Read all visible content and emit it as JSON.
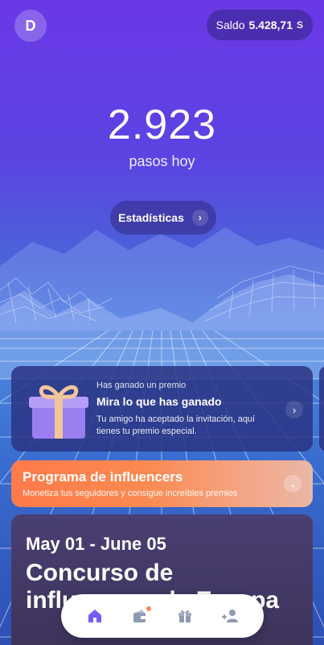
{
  "header": {
    "avatar_initial": "D",
    "balance_label": "Saldo",
    "balance_value": "5.428,71",
    "balance_currency_symbol": "S"
  },
  "steps": {
    "count": "2.923",
    "label": "pasos hoy",
    "stats_button": "Estadísticas"
  },
  "prize_card": {
    "kicker": "Has ganado un premio",
    "title": "Mira lo que has ganado",
    "description": "Tu amigo ha aceptado la invitación, aquí tienes tu premio especial."
  },
  "influencer_card": {
    "title": "Programa de influencers",
    "subtitle": "Monetiza tus seguidores y consigue increíbles premios"
  },
  "contest_card": {
    "dates": "May 01 - June 05",
    "title": "Concurso de influencers de Europa"
  },
  "tabbar": {
    "items": [
      "home-icon",
      "wallet-icon",
      "gift-icon",
      "friends-icon"
    ],
    "active_color": "#7a5af5",
    "inactive_color": "#8f99b2",
    "badge_color": "#f58a55"
  }
}
